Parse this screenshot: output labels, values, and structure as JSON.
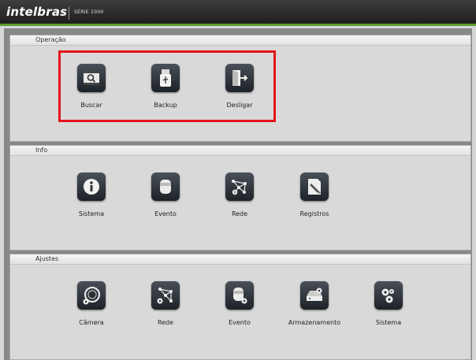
{
  "header": {
    "logo": "intelbras",
    "series": "SÉRIE 1000"
  },
  "sections": [
    {
      "title": "Operação",
      "items": [
        {
          "label": "Buscar",
          "icon": "search-video-icon"
        },
        {
          "label": "Backup",
          "icon": "usb-icon"
        },
        {
          "label": "Desligar",
          "icon": "logout-icon"
        }
      ]
    },
    {
      "title": "Info",
      "items": [
        {
          "label": "Sistema",
          "icon": "info-icon"
        },
        {
          "label": "Evento",
          "icon": "event-icon"
        },
        {
          "label": "Rede",
          "icon": "network-icon"
        },
        {
          "label": "Registros",
          "icon": "log-icon"
        }
      ]
    },
    {
      "title": "Ajustes",
      "items": [
        {
          "label": "Câmera",
          "icon": "camera-icon"
        },
        {
          "label": "Rede",
          "icon": "network-settings-icon"
        },
        {
          "label": "Evento",
          "icon": "event-settings-icon"
        },
        {
          "label": "Armazenamento",
          "icon": "storage-icon"
        },
        {
          "label": "Sistema",
          "icon": "system-settings-icon"
        }
      ]
    }
  ],
  "highlight_color": "#e3141b"
}
